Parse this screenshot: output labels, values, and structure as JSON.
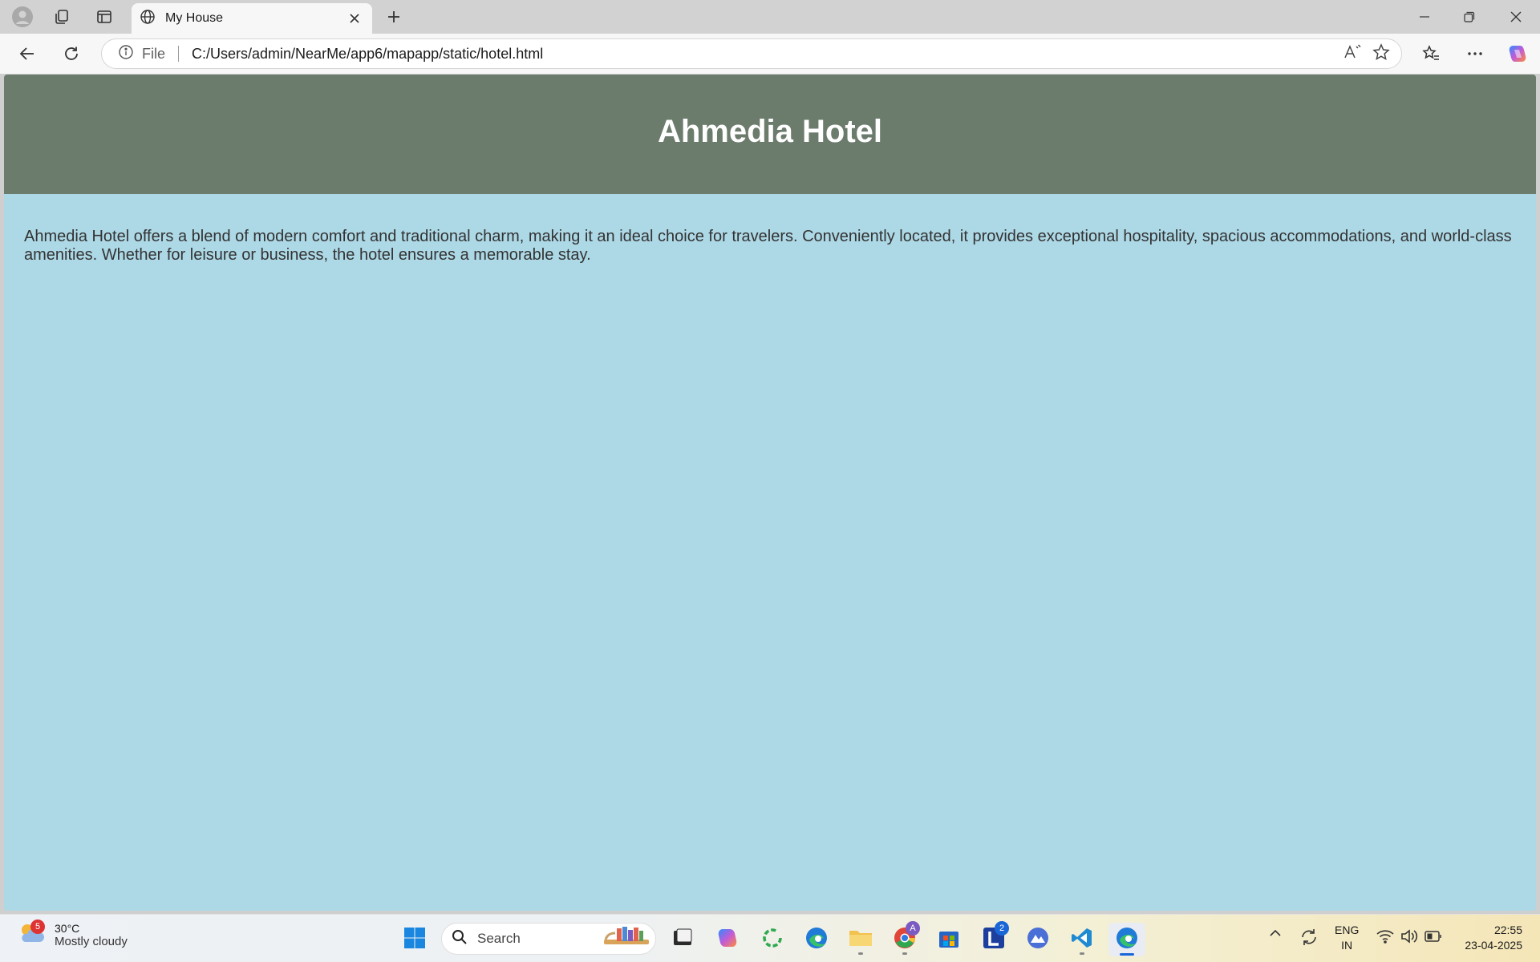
{
  "browser": {
    "tab_title": "My House",
    "address_prefix": "File",
    "url": "C:/Users/admin/NearMe/app6/mapapp/static/hotel.html"
  },
  "page": {
    "title": "Ahmedia Hotel",
    "description": "Ahmedia Hotel offers a blend of modern comfort and traditional charm, making it an ideal choice for travelers. Conveniently located, it provides exceptional hospitality, spacious accommodations, and world-class amenities. Whether for leisure or business, the hotel ensures a memorable stay.",
    "header_color": "#6b7b6c",
    "body_color": "#add8e6"
  },
  "taskbar": {
    "weather": {
      "badge": "5",
      "temperature": "30°C",
      "condition": "Mostly cloudy"
    },
    "search_placeholder": "Search",
    "app_badges": {
      "l_app": "2"
    },
    "language": {
      "line1": "ENG",
      "line2": "IN"
    },
    "clock": {
      "time": "22:55",
      "date": "23-04-2025"
    }
  }
}
